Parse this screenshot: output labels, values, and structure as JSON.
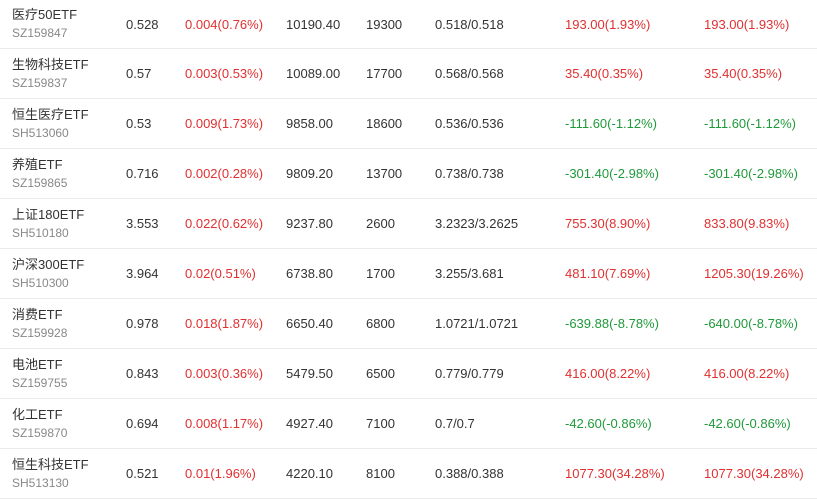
{
  "colors": {
    "up": "#e03030",
    "down": "#1f9a3a",
    "text": "#333333",
    "subtext": "#888888"
  },
  "holdings": [
    {
      "name": "医疗50ETF",
      "code": "SZ159847",
      "price": "0.528",
      "change": "0.004(0.76%)",
      "change_dir": "up",
      "market_value": "10190.40",
      "shares": "19300",
      "cost": "0.518/0.518",
      "pnl": "193.00(1.93%)",
      "pnl_dir": "up",
      "total_pnl": "193.00(1.93%)",
      "total_dir": "up"
    },
    {
      "name": "生物科技ETF",
      "code": "SZ159837",
      "price": "0.57",
      "change": "0.003(0.53%)",
      "change_dir": "up",
      "market_value": "10089.00",
      "shares": "17700",
      "cost": "0.568/0.568",
      "pnl": "35.40(0.35%)",
      "pnl_dir": "up",
      "total_pnl": "35.40(0.35%)",
      "total_dir": "up"
    },
    {
      "name": "恒生医疗ETF",
      "code": "SH513060",
      "price": "0.53",
      "change": "0.009(1.73%)",
      "change_dir": "up",
      "market_value": "9858.00",
      "shares": "18600",
      "cost": "0.536/0.536",
      "pnl": "-111.60(-1.12%)",
      "pnl_dir": "down",
      "total_pnl": "-111.60(-1.12%)",
      "total_dir": "down"
    },
    {
      "name": "养殖ETF",
      "code": "SZ159865",
      "price": "0.716",
      "change": "0.002(0.28%)",
      "change_dir": "up",
      "market_value": "9809.20",
      "shares": "13700",
      "cost": "0.738/0.738",
      "pnl": "-301.40(-2.98%)",
      "pnl_dir": "down",
      "total_pnl": "-301.40(-2.98%)",
      "total_dir": "down"
    },
    {
      "name": "上证180ETF",
      "code": "SH510180",
      "price": "3.553",
      "change": "0.022(0.62%)",
      "change_dir": "up",
      "market_value": "9237.80",
      "shares": "2600",
      "cost": "3.2323/3.2625",
      "pnl": "755.30(8.90%)",
      "pnl_dir": "up",
      "total_pnl": "833.80(9.83%)",
      "total_dir": "up"
    },
    {
      "name": "沪深300ETF",
      "code": "SH510300",
      "price": "3.964",
      "change": "0.02(0.51%)",
      "change_dir": "up",
      "market_value": "6738.80",
      "shares": "1700",
      "cost": "3.255/3.681",
      "pnl": "481.10(7.69%)",
      "pnl_dir": "up",
      "total_pnl": "1205.30(19.26%)",
      "total_dir": "up"
    },
    {
      "name": "消费ETF",
      "code": "SZ159928",
      "price": "0.978",
      "change": "0.018(1.87%)",
      "change_dir": "up",
      "market_value": "6650.40",
      "shares": "6800",
      "cost": "1.0721/1.0721",
      "pnl": "-639.88(-8.78%)",
      "pnl_dir": "down",
      "total_pnl": "-640.00(-8.78%)",
      "total_dir": "down"
    },
    {
      "name": "电池ETF",
      "code": "SZ159755",
      "price": "0.843",
      "change": "0.003(0.36%)",
      "change_dir": "up",
      "market_value": "5479.50",
      "shares": "6500",
      "cost": "0.779/0.779",
      "pnl": "416.00(8.22%)",
      "pnl_dir": "up",
      "total_pnl": "416.00(8.22%)",
      "total_dir": "up"
    },
    {
      "name": "化工ETF",
      "code": "SZ159870",
      "price": "0.694",
      "change": "0.008(1.17%)",
      "change_dir": "up",
      "market_value": "4927.40",
      "shares": "7100",
      "cost": "0.7/0.7",
      "pnl": "-42.60(-0.86%)",
      "pnl_dir": "down",
      "total_pnl": "-42.60(-0.86%)",
      "total_dir": "down"
    },
    {
      "name": "恒生科技ETF",
      "code": "SH513130",
      "price": "0.521",
      "change": "0.01(1.96%)",
      "change_dir": "up",
      "market_value": "4220.10",
      "shares": "8100",
      "cost": "0.388/0.388",
      "pnl": "1077.30(34.28%)",
      "pnl_dir": "up",
      "total_pnl": "1077.30(34.28%)",
      "total_dir": "up"
    }
  ]
}
